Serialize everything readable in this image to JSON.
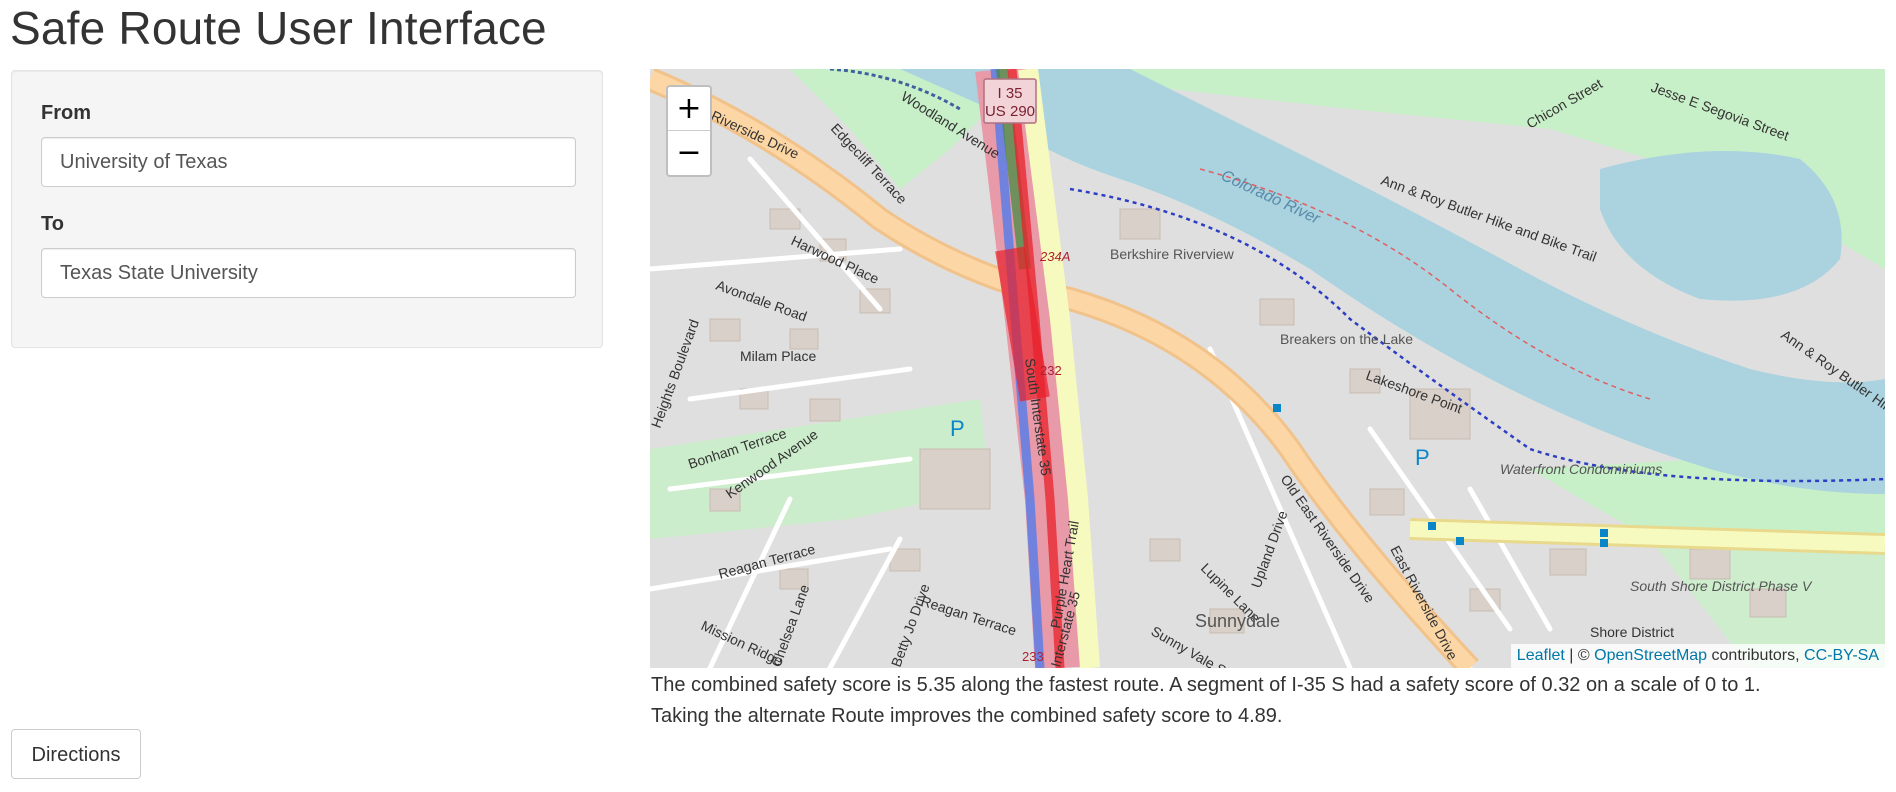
{
  "page": {
    "title": "Safe Route User Interface"
  },
  "form": {
    "from_label": "From",
    "from_value": "University of Texas",
    "to_label": "To",
    "to_value": "Texas State University",
    "directions_label": "Directions"
  },
  "map": {
    "zoom_in": "+",
    "zoom_out": "−",
    "attribution": {
      "leaflet": "Leaflet",
      "separator": " | © ",
      "osm": "OpenStreetMap",
      "contributors": " contributors, ",
      "license": "CC-BY-SA"
    },
    "labels": {
      "riverside_drive": "Riverside Drive",
      "edgecliff": "Edgecliff Terrace",
      "woodland": "Woodland Avenue",
      "harwood": "Harwood Place",
      "avondale": "Avondale Road",
      "milam": "Milam Place",
      "heights": "Heights Boulevard",
      "bonham": "Bonham Terrace",
      "kenwood": "Kenwood Avenue",
      "reagan1": "Reagan Terrace",
      "reagan2": "Reagan Terrace",
      "mission": "Mission Ridge",
      "chelsea": "Chelsea Lane",
      "betty": "Betty Jo Drive",
      "south_i35": "South Interstate 35",
      "purple_heart": "Purple Heart Trail",
      "i35_bottom": "Interstate 35",
      "shield_i35": "I 35",
      "shield_us290": "US 290",
      "exit234a": "234A",
      "exit232": "232",
      "exit233": "233",
      "berkshire": "Berkshire Riverview",
      "breakers": "Breakers on the Lake",
      "lakeshore": "Lakeshore Point",
      "waterfront": "Waterfront Condominiums",
      "old_east": "Old East Riverside Drive",
      "upland": "Upland Drive",
      "lupine": "Lupine Lane",
      "sunny_vale": "Sunny Vale St",
      "sunnydale": "Sunnydale",
      "east_riverside": "East Riverside Drive",
      "south_shore": "South Shore District Phase V",
      "shore_district": "Shore District",
      "colorado_river": "Colorado River",
      "ann_butler": "Ann & Roy Butler Hike and Bike Trail",
      "ann_butler_2": "Ann & Roy Butler Hike",
      "chicon": "Chicon Street",
      "jesse": "Jesse E Segovia Street",
      "parking": "P"
    },
    "colors": {
      "water": "#aad3df",
      "park": "#c8f0c8",
      "road_major": "#fcd6a4",
      "road_trunk": "#f7fabf",
      "route_fast": "#e8202a",
      "route_alt": "#5a7ee6",
      "route_green": "#3c8c3c"
    }
  },
  "summary": {
    "line1": "The combined safety score is 5.35 along the fastest route. A segment of I-35 S had a safety score of 0.32 on a scale of 0 to 1.",
    "line2": "Taking the alternate Route improves the combined safety score to 4.89."
  }
}
